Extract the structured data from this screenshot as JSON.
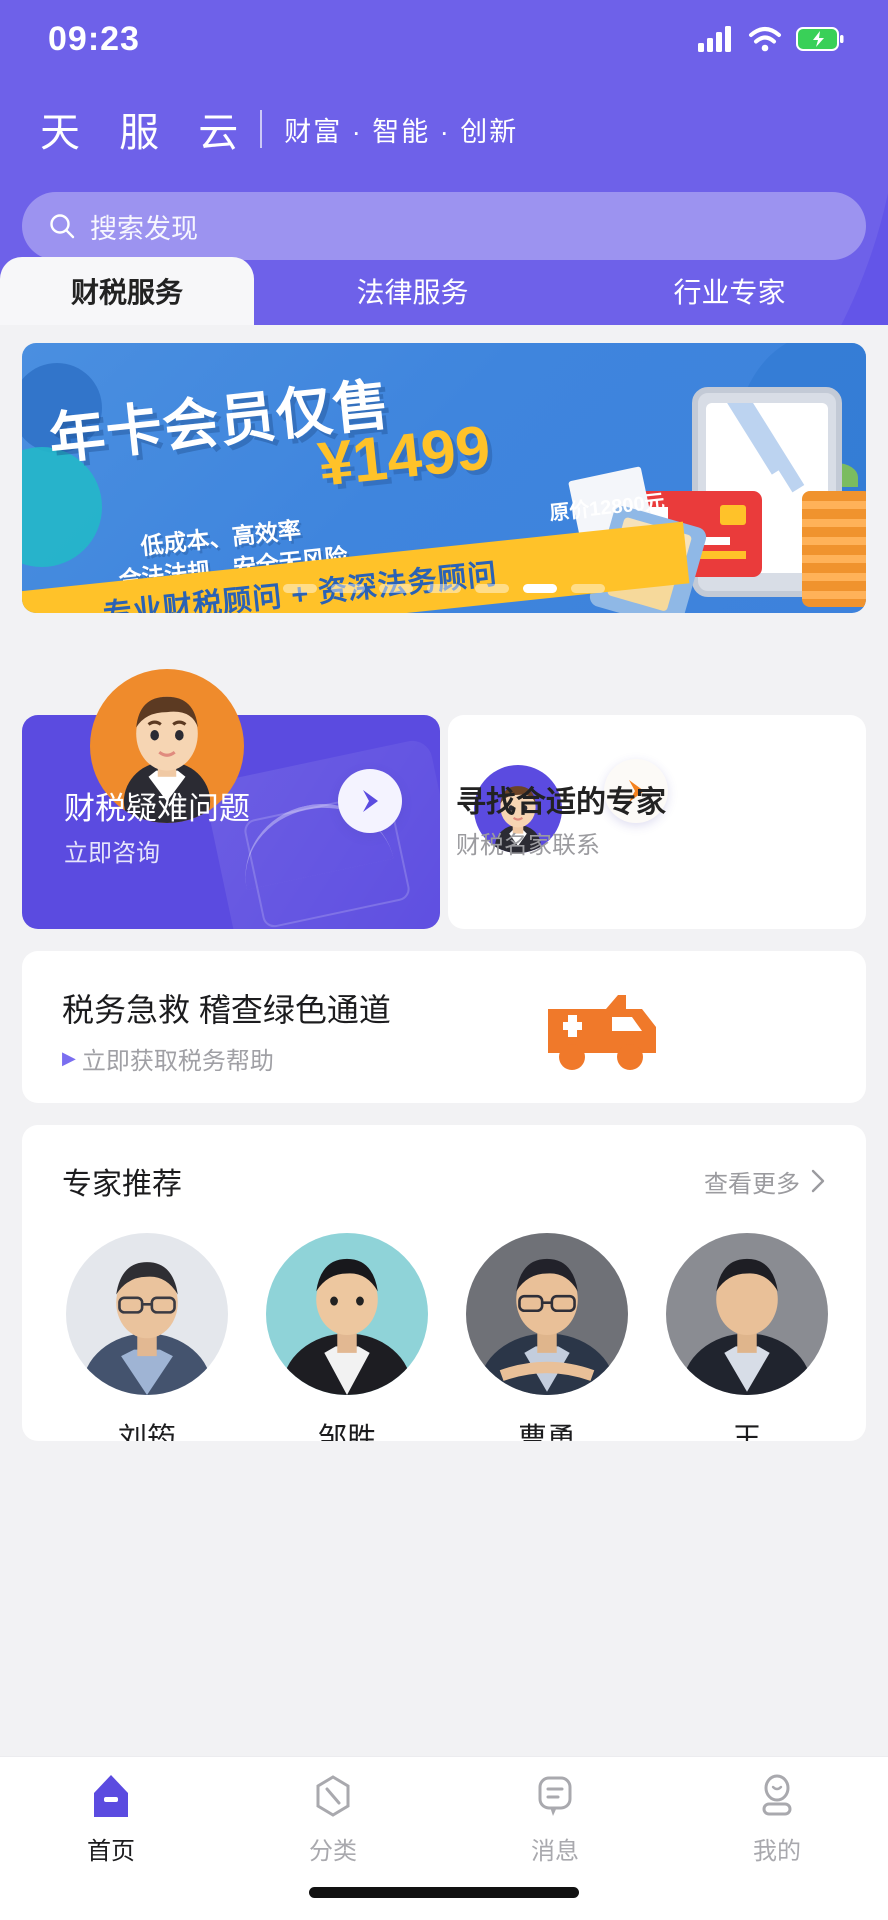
{
  "status_bar": {
    "time": "09:23",
    "icons": [
      "signal-icon",
      "wifi-icon",
      "battery-charging-icon"
    ]
  },
  "header": {
    "brand_name": "天 服 云",
    "brand_slogan": "财富 · 智能 · 创新",
    "search": {
      "placeholder": "搜索发现",
      "icon": "search-icon"
    }
  },
  "tabs": [
    {
      "label": "财税服务",
      "active": true
    },
    {
      "label": "法律服务",
      "active": false
    },
    {
      "label": "行业专家",
      "active": false
    }
  ],
  "banner": {
    "title": "年卡会员仅售",
    "price": "¥1499",
    "original_price": "原价12800元",
    "tagline1": "低成本、高效率",
    "tagline2": "合法法规、安全无风险",
    "ribbon_text": "专业财税顾问 + 资深法务顾问",
    "dots_total": 7,
    "dots_active_index": 5
  },
  "duo_cards": {
    "left": {
      "title": "财税疑难问题",
      "subtitle": "立即咨询",
      "avatar": "consultant-avatar",
      "action_icon": "play-icon"
    },
    "right": {
      "title": "寻找合适的专家",
      "subtitle": "财税名家联系",
      "avatar": "expert-avatar",
      "action_icon": "play-icon"
    }
  },
  "emergency_card": {
    "title": "税务急救 稽查绿色通道",
    "subtitle": "立即获取税务帮助",
    "caret": "▶",
    "icon": "ambulance-icon"
  },
  "experts_section": {
    "title": "专家推荐",
    "more_label": "查看更多",
    "more_icon": "chevron-right-icon",
    "experts": [
      {
        "name": "刘筠"
      },
      {
        "name": "邹胜"
      },
      {
        "name": "曹勇"
      },
      {
        "name": "王"
      }
    ]
  },
  "bottom_nav": [
    {
      "label": "首页",
      "icon": "home-icon",
      "active": true
    },
    {
      "label": "分类",
      "icon": "category-icon",
      "active": false
    },
    {
      "label": "消息",
      "icon": "message-icon",
      "active": false
    },
    {
      "label": "我的",
      "icon": "profile-icon",
      "active": false
    }
  ],
  "colors": {
    "brand_purple": "#6355e8",
    "card_purple": "#5b4be0",
    "accent_orange": "#f0792a",
    "banner_blue": "#3f85dd",
    "banner_yellow": "#ffc229"
  }
}
